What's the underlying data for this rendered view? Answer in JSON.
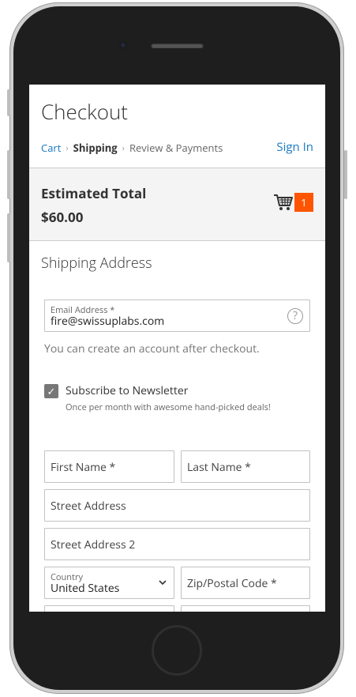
{
  "checkout": {
    "title": "Checkout",
    "breadcrumb": {
      "cart": "Cart",
      "separator": "›",
      "shipping": "Shipping",
      "review": "Review & Payments"
    },
    "sign_in": "Sign In"
  },
  "summary": {
    "label": "Estimated Total",
    "total": "$60.00",
    "cart_count": "1",
    "cart_icon": "shopping-cart-icon",
    "badge_color": "#ff5501"
  },
  "shipping": {
    "section_title": "Shipping Address",
    "email": {
      "label": "Email Address *",
      "value": "fire@swissuplabs.com",
      "help_icon": "?"
    },
    "account_hint": "You can create an account after checkout.",
    "newsletter": {
      "checked": true,
      "check_mark": "✓",
      "label": "Subscribe to Newsletter",
      "note": "Once per month with awesome hand-picked deals!"
    },
    "first_name_placeholder": "First Name *",
    "last_name_placeholder": "Last Name *",
    "street_placeholder": "Street Address",
    "street2_placeholder": "Street Address 2",
    "country": {
      "label": "Country",
      "value": "United States"
    },
    "zip_placeholder": "Zip/Postal Code *"
  },
  "colors": {
    "link": "#1979c3",
    "accent": "#ff5501"
  }
}
